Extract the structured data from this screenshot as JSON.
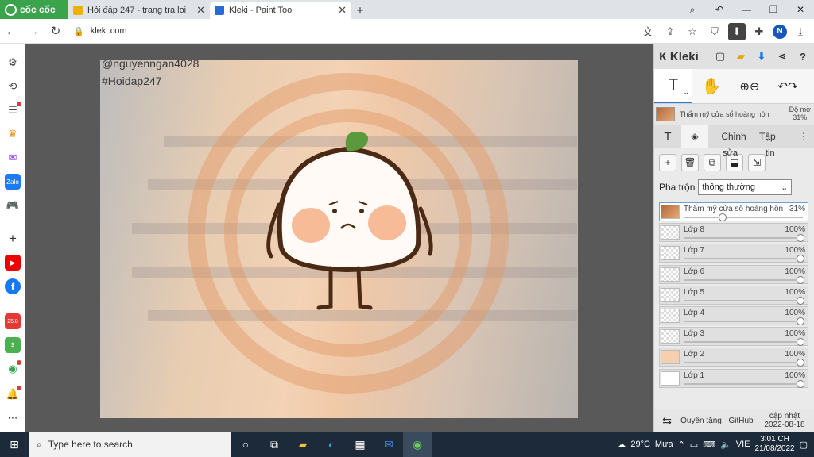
{
  "browser": {
    "brand": "cốc cốc",
    "tabs": [
      {
        "title": "Hỏi đáp 247 - trang tra loi",
        "color": "#f0b000"
      },
      {
        "title": "Kleki - Paint Tool",
        "color": "#2a6ad6"
      }
    ],
    "url": "kleki.com"
  },
  "canvas": {
    "watermark1": "@nguyenngan4028",
    "watermark2": "#Hoidap247"
  },
  "kleki": {
    "brand": "Kleki",
    "preset": {
      "name": "Thẩm mỹ cửa sổ hoàng hôn",
      "opacity_label": "Độ mờ",
      "opacity": "31%"
    },
    "tabs": {
      "adjust": "Chỉnh",
      "file": "Tập tin",
      "edit": "sửa"
    },
    "blend_label": "Pha trộn",
    "blend_value": "thông thường",
    "layers": [
      {
        "name": "Thẩm mỹ cửa sổ hoàng hôn",
        "pct": "31%",
        "fill": 0.31
      },
      {
        "name": "Lớp 8",
        "pct": "100%",
        "fill": 1
      },
      {
        "name": "Lớp 7",
        "pct": "100%",
        "fill": 1
      },
      {
        "name": "Lớp 6",
        "pct": "100%",
        "fill": 1
      },
      {
        "name": "Lớp 5",
        "pct": "100%",
        "fill": 1
      },
      {
        "name": "Lớp 4",
        "pct": "100%",
        "fill": 1
      },
      {
        "name": "Lớp 3",
        "pct": "100%",
        "fill": 1
      },
      {
        "name": "Lớp 2",
        "pct": "100%",
        "fill": 1
      },
      {
        "name": "Lớp 1",
        "pct": "100%",
        "fill": 1
      }
    ],
    "footer": {
      "privacy": "Quyền tặng",
      "github": "GitHub",
      "update1": "cập nhật",
      "update2": "2022-08-18"
    }
  },
  "taskbar": {
    "search_placeholder": "Type here to search",
    "weather": "29°C",
    "weather_text": "Mưa",
    "lang": "VIE",
    "time": "3:01 CH",
    "date": "21/08/2022"
  }
}
